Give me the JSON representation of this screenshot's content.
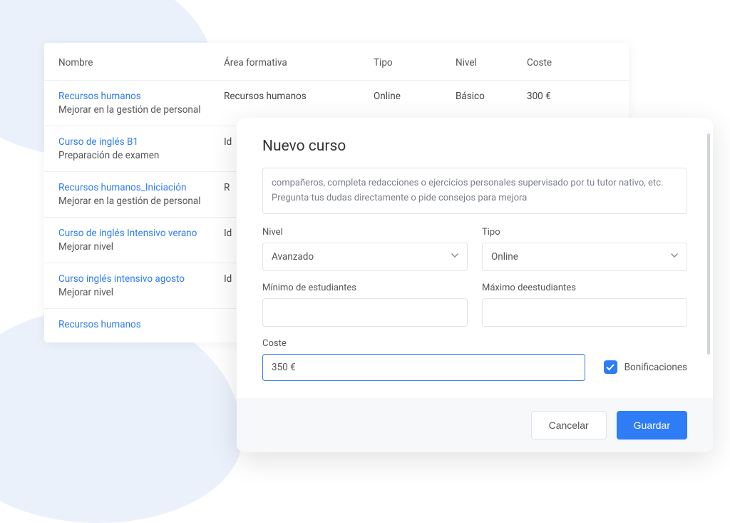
{
  "table": {
    "headers": {
      "nombre": "Nombre",
      "area": "Área formativa",
      "tipo": "Tipo",
      "nivel": "Nivel",
      "coste": "Coste"
    },
    "rows": [
      {
        "title": "Recursos humanos",
        "subtitle": "Mejorar en la gestión de personal",
        "area": "Recursos humanos",
        "tipo": "Online",
        "nivel": "Básico",
        "coste": "300 €"
      },
      {
        "title": "Curso de inglés B1",
        "subtitle": "Preparación de examen",
        "area": "Id",
        "tipo": "",
        "nivel": "",
        "coste": ""
      },
      {
        "title": "Recursos humanos_Iniciación",
        "subtitle": "Mejorar en la gestión de personal",
        "area": "R",
        "tipo": "",
        "nivel": "",
        "coste": ""
      },
      {
        "title": "Curso de inglés Intensivo verano",
        "subtitle": "Mejorar nivel",
        "area": "Id",
        "tipo": "",
        "nivel": "",
        "coste": ""
      },
      {
        "title": "Curso inglés intensivo agosto",
        "subtitle": "Mejorar nivel",
        "area": "Id",
        "tipo": "",
        "nivel": "",
        "coste": ""
      },
      {
        "title": "Recursos humanos",
        "subtitle": "",
        "area": "",
        "tipo": "",
        "nivel": "",
        "coste": ""
      }
    ]
  },
  "modal": {
    "title": "Nuevo curso",
    "description": "compañeros, completa redacciones o ejercicios personales supervisado por tu tutor nativo, etc. Pregunta tus dudas directamente o pide consejos para mejora",
    "labels": {
      "nivel": "Nivel",
      "tipo": "Tipo",
      "min": "Mínimo de estudiantes",
      "max": "Máximo deestudiantes",
      "coste": "Coste",
      "bonificaciones": "Bonificaciones"
    },
    "values": {
      "nivel": "Avanzado",
      "tipo": "Online",
      "coste": "350 €"
    },
    "buttons": {
      "cancel": "Cancelar",
      "save": "Guardar"
    }
  }
}
